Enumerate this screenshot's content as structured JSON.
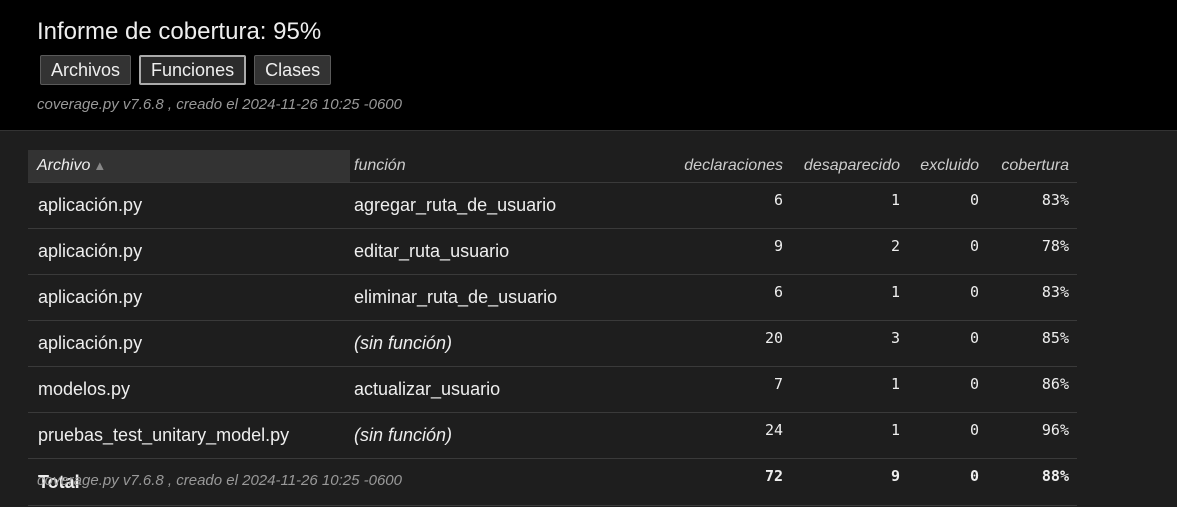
{
  "header": {
    "title": "Informe de cobertura: 95%",
    "tabs": [
      {
        "label": "Archivos",
        "active": false
      },
      {
        "label": "Funciones",
        "active": true
      },
      {
        "label": "Clases",
        "active": false
      }
    ],
    "stamp": "coverage.py v7.6.8 , creado el 2024-11-26 10:25 -0600"
  },
  "table": {
    "columns": [
      "Archivo",
      "función",
      "declaraciones",
      "desaparecido",
      "excluido",
      "cobertura"
    ],
    "sort_indicator": "▲",
    "rows": [
      {
        "file": "aplicación.py",
        "function": "agregar_ruta_de_usuario",
        "statements": "6",
        "missing": "1",
        "excluded": "0",
        "coverage": "83%"
      },
      {
        "file": "aplicación.py",
        "function": "editar_ruta_usuario",
        "statements": "9",
        "missing": "2",
        "excluded": "0",
        "coverage": "78%"
      },
      {
        "file": "aplicación.py",
        "function": "eliminar_ruta_de_usuario",
        "statements": "6",
        "missing": "1",
        "excluded": "0",
        "coverage": "83%"
      },
      {
        "file": "aplicación.py",
        "function": "(sin función)",
        "statements": "20",
        "missing": "3",
        "excluded": "0",
        "coverage": "85%"
      },
      {
        "file": "modelos.py",
        "function": "actualizar_usuario",
        "statements": "7",
        "missing": "1",
        "excluded": "0",
        "coverage": "86%"
      },
      {
        "file": "pruebas_test_unitary_model.py",
        "function": "(sin función)",
        "statements": "24",
        "missing": "1",
        "excluded": "0",
        "coverage": "96%"
      }
    ],
    "total": {
      "label": "Total",
      "statements": "72",
      "missing": "9",
      "excluded": "0",
      "coverage": "88%"
    }
  },
  "footer": {
    "stamp": "coverage.py v7.6.8 , creado el 2024-11-26 10:25 -0600"
  },
  "colors": {
    "header_bg": "#000000",
    "page_bg": "#1e1e1e",
    "text": "#eeeeee",
    "muted": "#999999"
  }
}
